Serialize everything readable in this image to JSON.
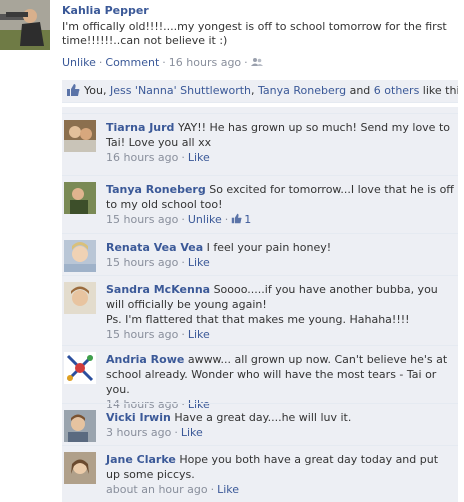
{
  "post": {
    "author": "Kahlia Pepper",
    "text": "I'm offically old!!!!....my yongest is off to school tomorrow for the first time!!!!!!..can not believe it :)",
    "actions": {
      "unlike": "Unlike",
      "comment": "Comment",
      "time": "16 hours ago"
    }
  },
  "likes": {
    "prefix": "You, ",
    "people": [
      "Jess 'Nanna' Shuttleworth",
      "Tanya Roneberg"
    ],
    "and": " and ",
    "others": "6 others",
    "suffix": " like this."
  },
  "comments": [
    {
      "name": "Tiarna Jurd",
      "text": "YAY!! He has grown up so much! Send my love to Tai! Love you all xx",
      "time": "16 hours ago",
      "action": "Like"
    },
    {
      "name": "Tanya Roneberg",
      "text": "So excited for tomorrow...I love that he is off to my old school too!",
      "time": "15 hours ago",
      "action": "Unlike",
      "likes": "1"
    },
    {
      "name": "Renata Vea Vea",
      "text": "I feel your pain honey!",
      "time": "15 hours ago",
      "action": "Like"
    },
    {
      "name": "Sandra McKenna",
      "text": "Soooo.....if you have another bubba, you will officially be young again!",
      "text2": "Ps. I'm flattered that that makes me young. Hahaha!!!!",
      "time": "15 hours ago",
      "action": "Like"
    },
    {
      "name": "Andria Rowe",
      "text": "awww... all grown up now. Can't believe he's at school already. Wonder who will have the most tears - Tai or you.",
      "time": "14 hours ago",
      "action": "Like"
    },
    {
      "name": "Vicki Irwin",
      "text": "Have a great day....he will luv it.",
      "time": "3 hours ago",
      "action": "Like"
    },
    {
      "name": "Jane Clarke",
      "text": "Hope you both have a great day today and put up some piccys.",
      "time": "about an hour ago",
      "action": "Like"
    }
  ],
  "colors": {
    "link": "#3b5998",
    "meta": "#898f9c",
    "panel": "#edeff4"
  },
  "icons": {
    "like": "thumbs-up-icon",
    "audience": "friends-icon"
  }
}
